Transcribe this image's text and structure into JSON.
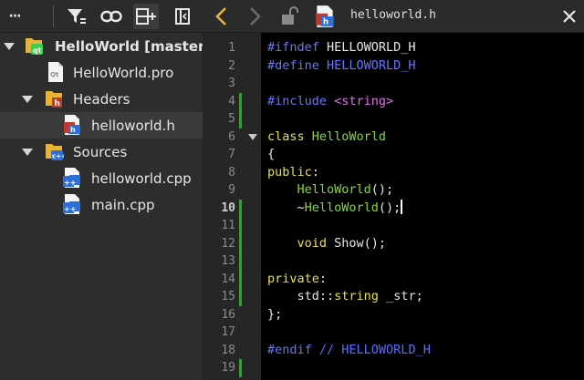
{
  "toolbar": {
    "more_label": "···",
    "buttons": [
      "filter-icon",
      "link-icon",
      "split-icon",
      "close-panel-icon"
    ]
  },
  "tree": {
    "project": "HelloWorld [master]",
    "pro_file": "HelloWorld.pro",
    "headers_folder": "Headers",
    "header_file": "helloworld.h",
    "sources_folder": "Sources",
    "source_file_1": "helloworld.cpp",
    "source_file_2": "main.cpp"
  },
  "editor": {
    "file_name": "helloworld.h",
    "current_line": 10,
    "lines": [
      {
        "n": "1",
        "tokens": [
          [
            "pre",
            "#ifndef "
          ],
          [
            "id",
            "HELLOWORLD_H"
          ]
        ]
      },
      {
        "n": "2",
        "tokens": [
          [
            "pre",
            "#define "
          ],
          [
            "mac",
            "HELLOWORLD_H"
          ]
        ]
      },
      {
        "n": "3",
        "tokens": []
      },
      {
        "n": "4",
        "tokens": [
          [
            "pre",
            "#include "
          ],
          [
            "str",
            "<string>"
          ]
        ]
      },
      {
        "n": "5",
        "tokens": []
      },
      {
        "n": "6",
        "tokens": [
          [
            "kw",
            "class "
          ],
          [
            "fn",
            "HelloWorld"
          ]
        ]
      },
      {
        "n": "7",
        "tokens": [
          [
            "id",
            "{"
          ]
        ]
      },
      {
        "n": "8",
        "tokens": [
          [
            "kw",
            "public"
          ],
          [
            "id",
            ":"
          ]
        ]
      },
      {
        "n": "9",
        "tokens": [
          [
            "id",
            "    "
          ],
          [
            "fn",
            "HelloWorld"
          ],
          [
            "id",
            "();"
          ]
        ]
      },
      {
        "n": "10",
        "tokens": [
          [
            "id",
            "    ~"
          ],
          [
            "fn",
            "HelloWorld"
          ],
          [
            "id",
            "();"
          ],
          [
            "cursor",
            ""
          ]
        ]
      },
      {
        "n": "11",
        "tokens": []
      },
      {
        "n": "12",
        "tokens": [
          [
            "id",
            "    "
          ],
          [
            "type",
            "void "
          ],
          [
            "id",
            "Show();"
          ]
        ]
      },
      {
        "n": "13",
        "tokens": []
      },
      {
        "n": "14",
        "tokens": [
          [
            "kw",
            "private"
          ],
          [
            "id",
            ":"
          ]
        ]
      },
      {
        "n": "15",
        "tokens": [
          [
            "id",
            "    "
          ],
          [
            "ns",
            "std::"
          ],
          [
            "type",
            "string "
          ],
          [
            "id",
            "_str;"
          ]
        ]
      },
      {
        "n": "16",
        "tokens": [
          [
            "id",
            "};"
          ]
        ]
      },
      {
        "n": "17",
        "tokens": []
      },
      {
        "n": "18",
        "tokens": [
          [
            "pre",
            "#endif "
          ],
          [
            "cmt",
            "// HELLOWORLD_H"
          ]
        ]
      },
      {
        "n": "19",
        "tokens": []
      }
    ]
  },
  "colors": {
    "accent_arrow": "#e8b339",
    "change_bar": "#3f9a3f",
    "qt_badge": "#41cd52",
    "header_badge": "#c0392b"
  }
}
